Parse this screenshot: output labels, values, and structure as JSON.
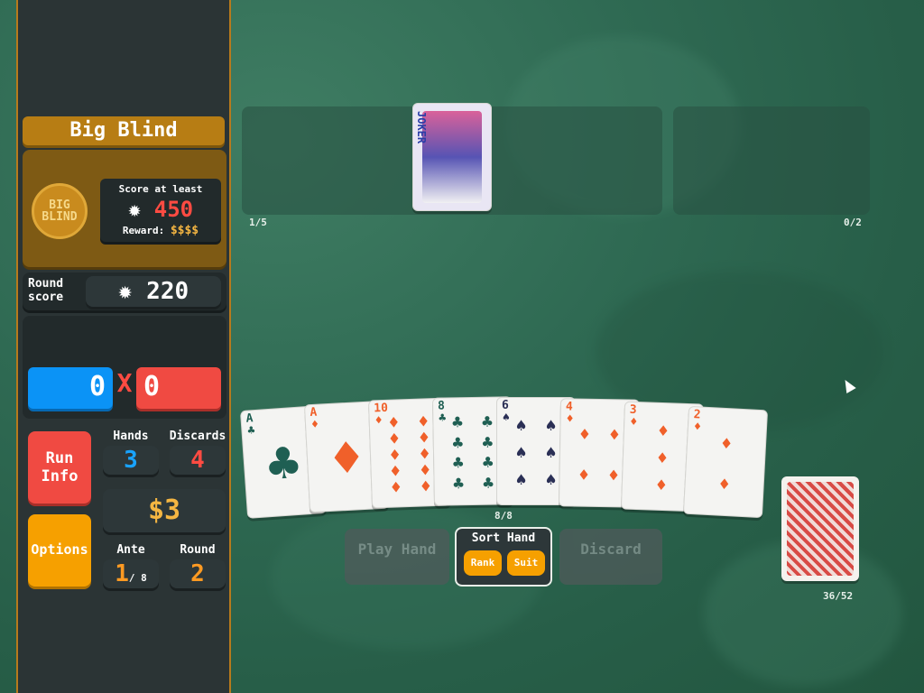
{
  "blind": {
    "title": "Big Blind",
    "chip_label": "BIG BLIND",
    "score_label": "Score at least",
    "target": "450",
    "reward_label": "Reward:",
    "reward": "$$$$"
  },
  "round": {
    "label_line1": "Round",
    "label_line2": "score",
    "score": "220"
  },
  "hand_eval": {
    "chips": "0",
    "x": "X",
    "mult": "0"
  },
  "buttons": {
    "run_info_1": "Run",
    "run_info_2": "Info",
    "options": "Options"
  },
  "stats": {
    "hands_label": "Hands",
    "hands": "3",
    "discards_label": "Discards",
    "discards": "4",
    "money": "$3",
    "ante_label": "Ante",
    "ante": "1",
    "ante_max": "/ 8",
    "round_label": "Round",
    "round": "2"
  },
  "jokers": {
    "count": "1/5",
    "joker_text": "JOKER"
  },
  "consumables": {
    "count": "0/2"
  },
  "hand": {
    "count": "8/8",
    "cards": [
      {
        "rank": "A",
        "suit": "♣",
        "color": "#1f5f53"
      },
      {
        "rank": "A",
        "suit": "♦",
        "color": "#f0602a"
      },
      {
        "rank": "10",
        "suit": "♦",
        "color": "#f0602a"
      },
      {
        "rank": "8",
        "suit": "♣",
        "color": "#1f5f53"
      },
      {
        "rank": "6",
        "suit": "♠",
        "color": "#2a2f55"
      },
      {
        "rank": "4",
        "suit": "♦",
        "color": "#f0602a"
      },
      {
        "rank": "3",
        "suit": "♦",
        "color": "#f0602a"
      },
      {
        "rank": "2",
        "suit": "♦",
        "color": "#f0602a"
      }
    ]
  },
  "actions": {
    "play": "Play Hand",
    "sort": "Sort Hand",
    "rank": "Rank",
    "suit": "Suit",
    "discard": "Discard"
  },
  "deck": {
    "count": "36/52"
  },
  "colors": {
    "accent": "#b77d14",
    "chips": "#0b93f6",
    "mult": "#f04a42",
    "button_red": "#f04a42",
    "button_orange": "#f6a000"
  }
}
